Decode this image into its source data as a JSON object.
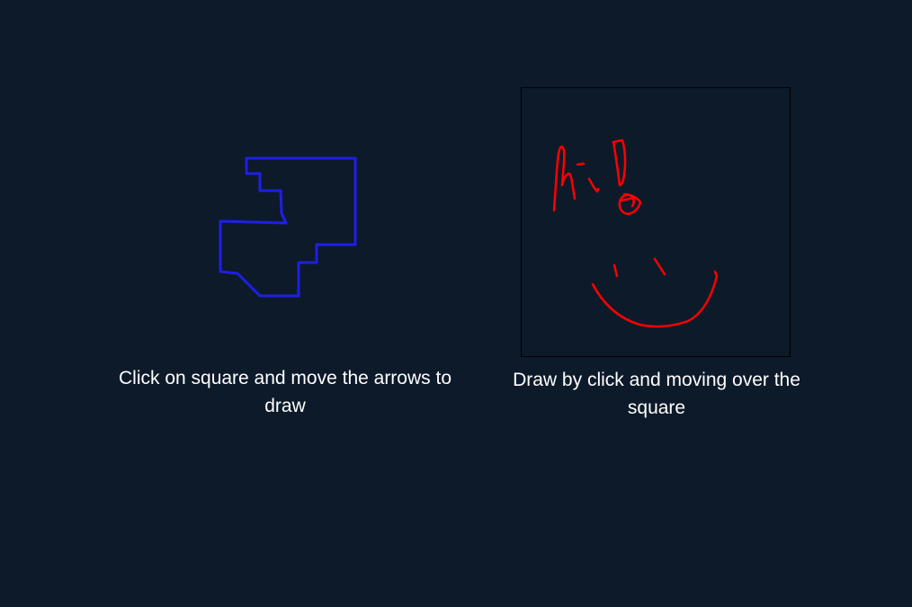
{
  "theme": {
    "background": "#0d1a2a",
    "arrow_stroke": "#1f1fe6",
    "freehand_stroke": "#ff0000",
    "canvas_border": "#000000",
    "text_color": "#ffffff"
  },
  "arrow_panel": {
    "caption": "Click on square and move the arrows to draw"
  },
  "draw_panel": {
    "caption": "Draw by click and moving over the square"
  }
}
